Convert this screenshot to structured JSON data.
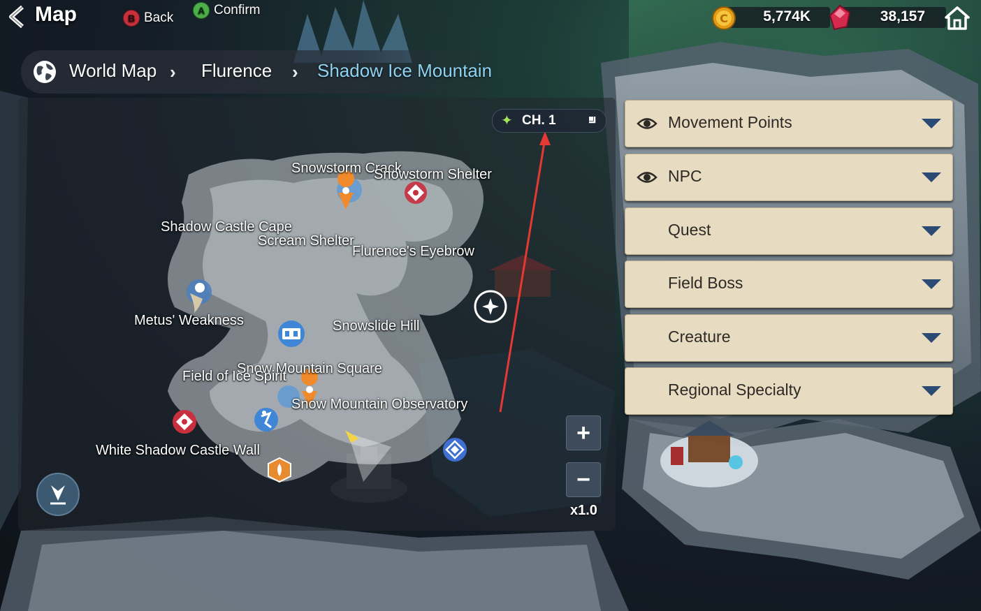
{
  "header": {
    "title": "Map",
    "back_hint": {
      "key": "B",
      "label": "Back"
    },
    "confirm_hint": {
      "key": "A",
      "label": "Confirm"
    }
  },
  "currency": {
    "gold": {
      "value": "5,774K",
      "icon": "gold-coin-icon",
      "color": "#f0a51f"
    },
    "gem": {
      "value": "38,157",
      "icon": "red-gem-icon",
      "color": "#e23a5b"
    }
  },
  "breadcrumb": {
    "items": [
      "World Map",
      "Flurence",
      "Shadow Ice Mountain"
    ]
  },
  "channel": {
    "label": "CH. 1"
  },
  "map_labels": [
    "Snowstorm Crack",
    "Snowstorm Shelter",
    "Shadow Castle Cape",
    "Scream Shelter",
    "Flurence's Eyebrow",
    "Metus' Weakness",
    "Snowslide Hill",
    "Snow Mountain Square",
    "Field of Ice Spirit",
    "Snow Mountain Observatory",
    "White Shadow Castle Wall"
  ],
  "zoom": {
    "plus": "+",
    "minus": "−",
    "level": "x1.0"
  },
  "filters": [
    {
      "label": "Movement Points",
      "visible": true
    },
    {
      "label": "NPC",
      "visible": true
    },
    {
      "label": "Quest",
      "visible": false
    },
    {
      "label": "Field Boss",
      "visible": false
    },
    {
      "label": "Creature",
      "visible": false
    },
    {
      "label": "Regional Specialty",
      "visible": false
    }
  ],
  "colors": {
    "filter_bg": "#e7dcc2",
    "filter_text": "#2d2a26",
    "caret": "#2c4b74",
    "breadcrumb_active": "#8fd3f2",
    "annotation_arrow": "#e53935"
  }
}
